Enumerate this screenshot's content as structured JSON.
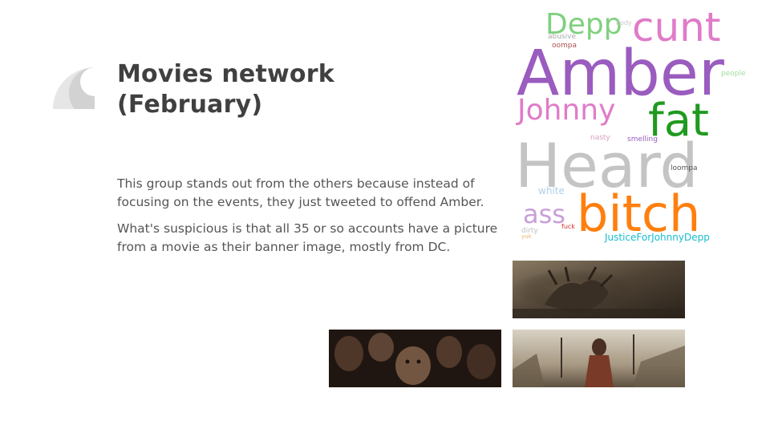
{
  "slide": {
    "title_line1": "Movies network",
    "title_line2": "(February)",
    "paragraph1": "This group stands out from the others because instead of focusing on the events, they just tweeted to offend Amber.",
    "paragraph2": "What's suspicious is that all 35 or so accounts have a picture from a movie as their banner image, mostly from DC."
  },
  "wordcloud": {
    "words": {
      "depp": "Depp",
      "cunt": "cunt",
      "amber": "Amber",
      "johnny": "Johnny",
      "fat": "fat",
      "heard": "Heard",
      "bitch": "bitch",
      "ass": "ass",
      "white": "white",
      "body": "body",
      "abusive": "abusive",
      "oompa": "oompa",
      "people": "people",
      "nasty": "nasty",
      "smelling": "smelling",
      "loompa": "loompa",
      "fuck": "fuck",
      "dirty": "dirty",
      "yuk": "yuk",
      "justice": "JusticeForJohnnyDepp"
    },
    "colors": {
      "amber": "#9a5cbf",
      "cunt": "#e07bc8",
      "depp": "#7fd07f",
      "johnny": "#e07bc8",
      "fat": "#1f9a1f",
      "heard": "#c4c4c4",
      "bitch": "#ff7f0e",
      "ass": "#c8a0d8",
      "justice": "#17becf"
    }
  },
  "banners": [
    {
      "name": "creature-banner",
      "description_icon": "movie-still-image"
    },
    {
      "name": "goblins-banner",
      "description_icon": "movie-still-image"
    },
    {
      "name": "warrior-banner",
      "description_icon": "movie-still-image"
    }
  ]
}
